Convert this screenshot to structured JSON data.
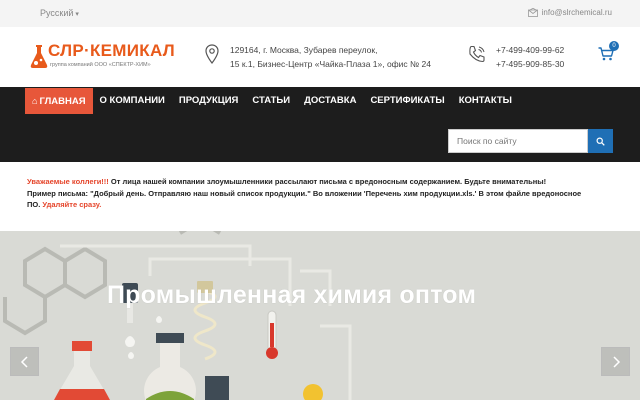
{
  "topbar": {
    "language": "Русский",
    "email": "info@slrchemical.ru"
  },
  "header": {
    "logo_text": "СЛР·КЕМИКАЛ",
    "logo_sub": "группа компаний ООО «СПЕКТР-ХИМ»",
    "address_line1": "129164, г. Москва, Зубарев переулок,",
    "address_line2": "15 к.1, Бизнес-Центр «Чайка-Плаза 1», офис № 24",
    "phone1": "+7-499-409-99-62",
    "phone2": "+7-495-909-85-30",
    "cart_count": "0"
  },
  "nav": {
    "items": [
      {
        "label": "ГЛАВНАЯ"
      },
      {
        "label": "О КОМПАНИИ"
      },
      {
        "label": "ПРОДУКЦИЯ"
      },
      {
        "label": "СТАТЬИ"
      },
      {
        "label": "ДОСТАВКА"
      },
      {
        "label": "СЕРТИФИКАТЫ"
      },
      {
        "label": "КОНТАКТЫ"
      }
    ],
    "search_placeholder": "Поиск по сайту"
  },
  "warning": {
    "highlight": "Уважаемые коллеги!!!",
    "text1": " От лица нашей компании злоумышленники рассылают письма с вредоносным содержанием. Будьте внимательны!",
    "text2": "Пример письма: \"Добрый день. Отправляю наш новый список продукции.\" Во вложении 'Перечень хим продукции.xls.' В этом файле вредоносное",
    "text3": "ПО. ",
    "action": "Удаляйте сразу."
  },
  "hero": {
    "title": "Промышленная химия оптом"
  },
  "colors": {
    "accent_orange": "#e85a1b",
    "active_menu": "#e7573a",
    "blue": "#1f6fb5",
    "nav_bg": "#1d1d1d"
  }
}
